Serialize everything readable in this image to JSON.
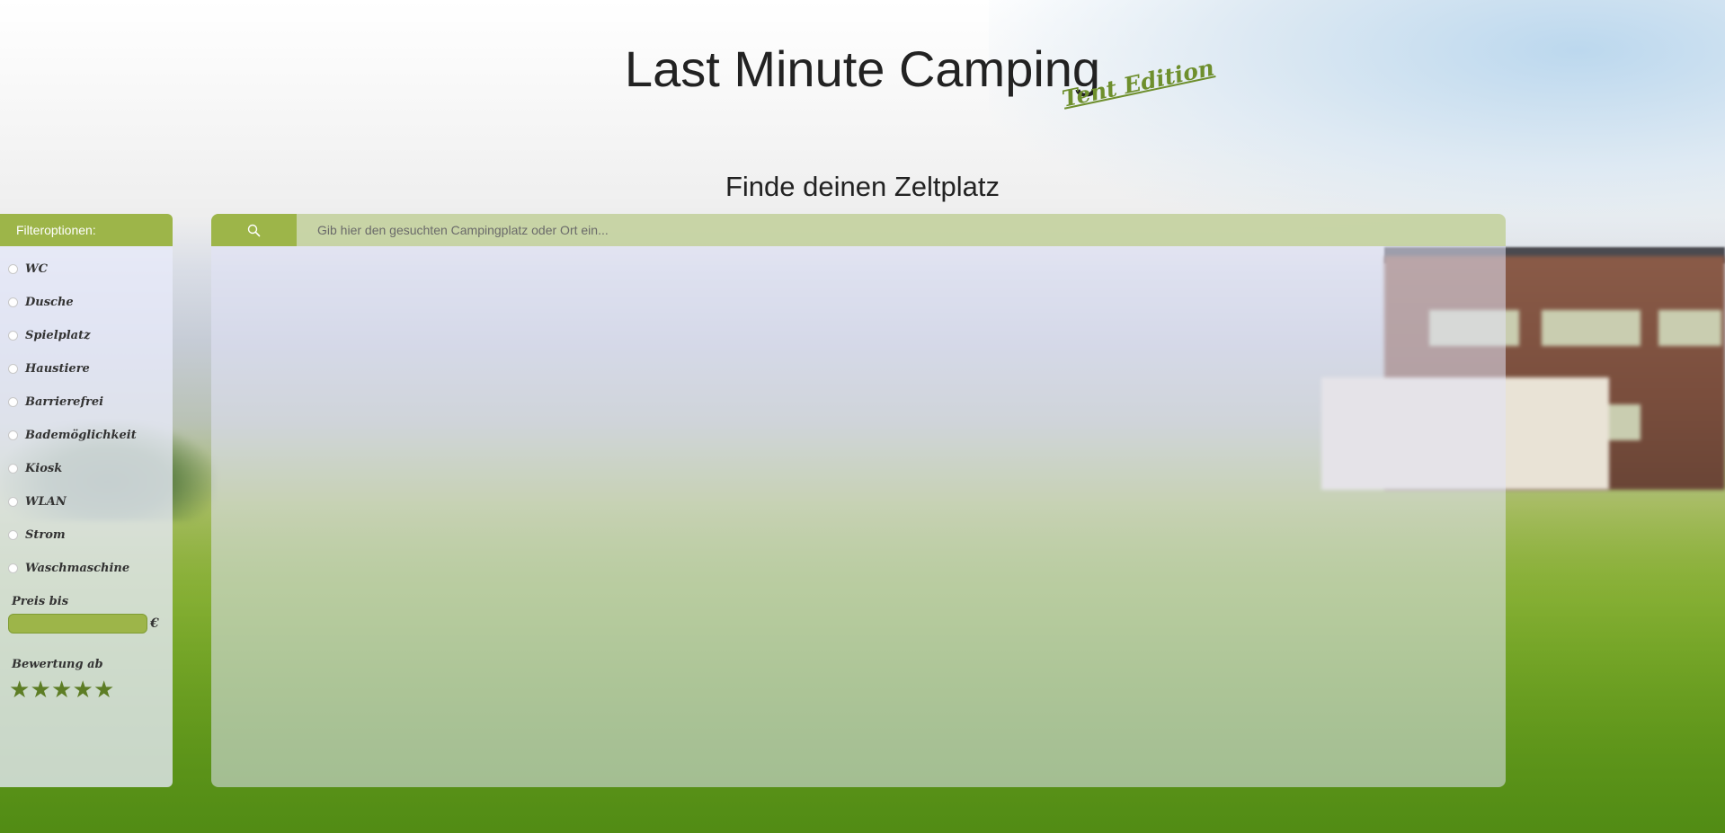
{
  "header": {
    "title": "Last Minute Camping",
    "badge": "Tent Edition"
  },
  "main": {
    "section_title": "Finde deinen Zeltplatz"
  },
  "filters": {
    "heading": "Filteroptionen:",
    "options": [
      {
        "label": "WC",
        "checked": false
      },
      {
        "label": "Dusche",
        "checked": false
      },
      {
        "label": "Spielplatz",
        "checked": false
      },
      {
        "label": "Haustiere",
        "checked": false
      },
      {
        "label": "Barrierefrei",
        "checked": false
      },
      {
        "label": "Bademöglichkeit",
        "checked": false
      },
      {
        "label": "Kiosk",
        "checked": false
      },
      {
        "label": "WLAN",
        "checked": false
      },
      {
        "label": "Strom",
        "checked": false
      },
      {
        "label": "Waschmaschine",
        "checked": false
      }
    ],
    "price": {
      "label": "Preis bis",
      "value": "",
      "currency": "€"
    },
    "rating": {
      "label": "Bewertung ab",
      "stars": [
        "★",
        "★",
        "★",
        "★",
        "★"
      ]
    }
  },
  "search": {
    "icon": "search-icon",
    "placeholder": "Gib hier den gesuchten Campingplatz oder Ort ein...",
    "value": ""
  },
  "colors": {
    "accent": "#9db549",
    "badge": "#6e8f2d",
    "star": "#5d7d25"
  }
}
